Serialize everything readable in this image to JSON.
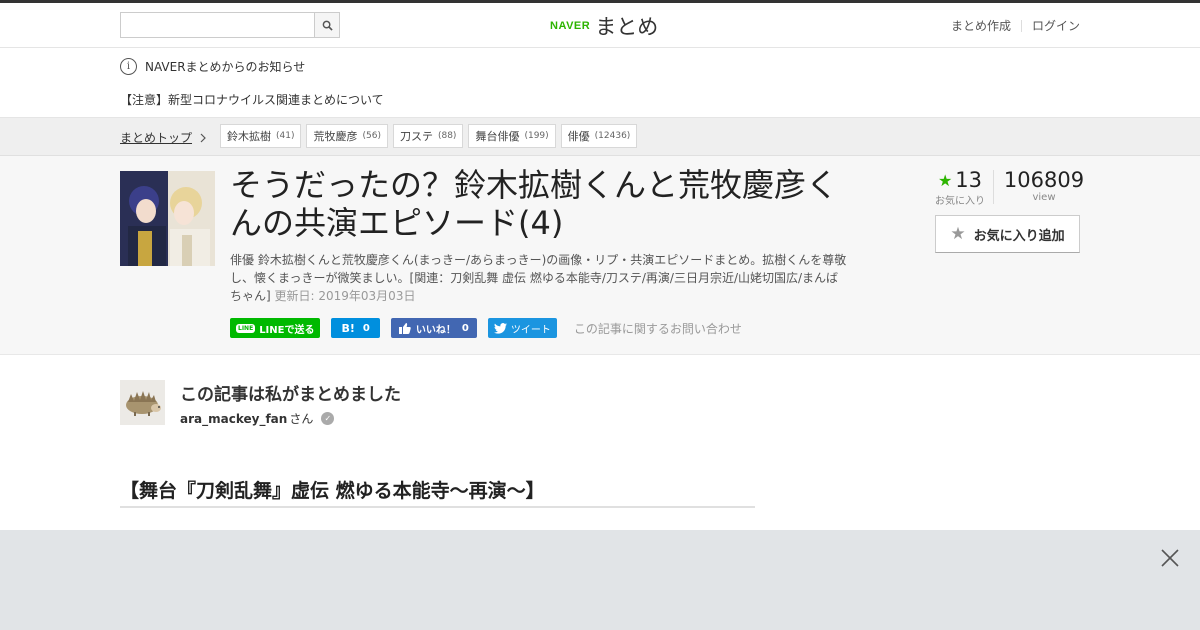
{
  "header": {
    "search_placeholder": "",
    "logo_naver": "NAVER",
    "logo_matome": "まとめ",
    "links": [
      "まとめ作成",
      "ログイン"
    ]
  },
  "notice": {
    "title": "NAVERまとめからのお知らせ",
    "item": "【注意】新型コロナウイルス関連まとめについて"
  },
  "breadcrumb": {
    "home": "まとめトップ",
    "tags": [
      {
        "label": "鈴木拡樹",
        "count": "(41)"
      },
      {
        "label": "荒牧慶彦",
        "count": "(56)"
      },
      {
        "label": "刀ステ",
        "count": "(88)"
      },
      {
        "label": "舞台俳優",
        "count": "(199)"
      },
      {
        "label": "俳優",
        "count": "(12436)"
      }
    ]
  },
  "article": {
    "title": "そうだったの？鈴木拡樹くんと荒牧慶彦くんの共演エピソード(4)",
    "description": "俳優 鈴木拡樹くんと荒牧慶彦くん(まっきー/あらまっきー)の画像・リプ・共演エピソードまとめ。拡樹くんを尊敬し、懐くまっきーが微笑ましい。[関連：刀剣乱舞 虚伝 燃ゆる本能寺/刀ステ/再演/三日月宗近/山姥切国広/まんばちゃん]",
    "updated": "更新日: 2019年03月03日"
  },
  "share": {
    "line": "LINEで送る",
    "line_mark": "LINE",
    "hatena_label": "B!",
    "hatena_count": "0",
    "fb_label": "いいね！",
    "fb_count": "0",
    "tweet": "ツイート",
    "contact": "この記事に関するお問い合わせ"
  },
  "stats": {
    "favorites": "13",
    "favorites_label": "お気に入り",
    "views": "106809",
    "views_label": "view",
    "fav_button": "お気に入り追加"
  },
  "author": {
    "heading": "この記事は私がまとめました",
    "name": "ara_mackey_fan",
    "suffix": "さん"
  },
  "section": {
    "heading": "【舞台『刀剣乱舞』虚伝 燃ゆる本能寺～再演～】"
  },
  "colors": {
    "naver_green": "#2db400",
    "line_green": "#00b900",
    "hatena_blue": "#008fde",
    "facebook_blue": "#4267b2",
    "twitter_blue": "#1b95e0",
    "overlay_gray": "#e1e4e7"
  }
}
